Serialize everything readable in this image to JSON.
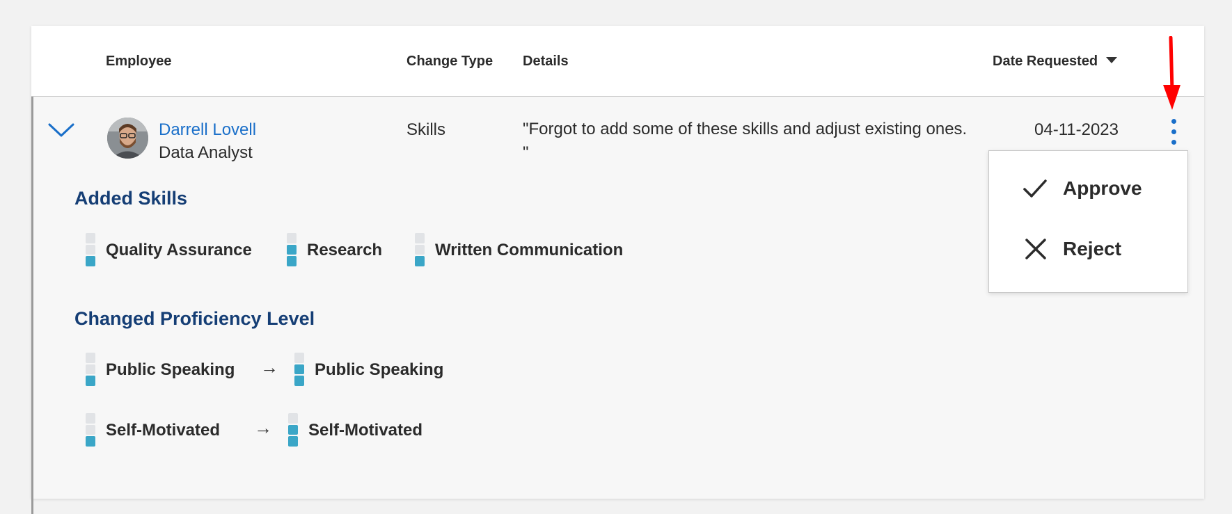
{
  "table": {
    "columns": {
      "employee": "Employee",
      "change_type": "Change Type",
      "details": "Details",
      "date_requested": "Date Requested"
    }
  },
  "row": {
    "employee_name": "Darrell Lovell",
    "employee_title": "Data Analyst",
    "change_type": "Skills",
    "details": "\"Forgot to add some of these skills and adjust existing ones. \"",
    "date": "04-11-2023"
  },
  "added_skills": {
    "title": "Added Skills",
    "items": [
      {
        "label": "Quality Assurance",
        "level": 1
      },
      {
        "label": "Research",
        "level": 2
      },
      {
        "label": "Written Communication",
        "level": 1
      }
    ]
  },
  "changed_proficiency": {
    "title": "Changed Proficiency Level",
    "items": [
      {
        "from_label": "Public Speaking",
        "from_level": 1,
        "to_label": "Public Speaking",
        "to_level": 2
      },
      {
        "from_label": "Self-Motivated",
        "from_level": 1,
        "to_label": "Self-Motivated",
        "to_level": 2
      }
    ],
    "arrow": "→"
  },
  "menu": {
    "approve": "Approve",
    "reject": "Reject"
  },
  "colors": {
    "link": "#1a6fc9",
    "section_title": "#153e75",
    "meter_fill": "#3aa6c7",
    "annotation_arrow": "#ff0000"
  },
  "icons": {
    "expand": "chevron-down-icon",
    "more": "kebab-menu-icon",
    "approve": "checkmark-icon",
    "reject": "close-icon",
    "sort": "sort-descending-icon"
  }
}
